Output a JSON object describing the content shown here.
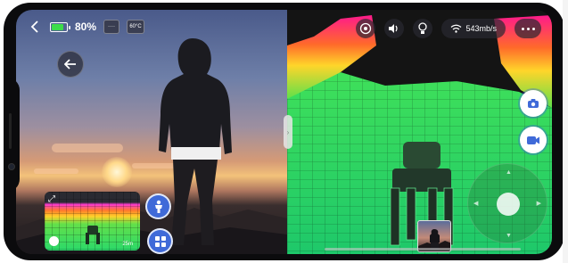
{
  "status_bar": {
    "battery_percent": "80%",
    "battery_level": 0.8,
    "temperature": "60°C",
    "signal_chip": "····"
  },
  "network": {
    "speed": "543mb/s"
  },
  "mini_map": {
    "scale": "25m"
  },
  "colors": {
    "accent_blue": "#3f6ad8",
    "battery_green": "#3ddc4a",
    "lidar_green": "#2bd96a"
  },
  "icons": {
    "back": "chevron-left-icon",
    "round_back": "arrow-left-icon",
    "battery": "battery-icon",
    "target": "target-icon",
    "volume": "volume-icon",
    "lightbulb": "lightbulb-icon",
    "wifi": "wifi-icon",
    "more": "more-icon",
    "photo": "camera-icon",
    "video": "video-camera-icon",
    "person": "person-icon",
    "apps": "apps-grid-icon",
    "expand": "expand-icon",
    "compass": "compass-icon"
  }
}
